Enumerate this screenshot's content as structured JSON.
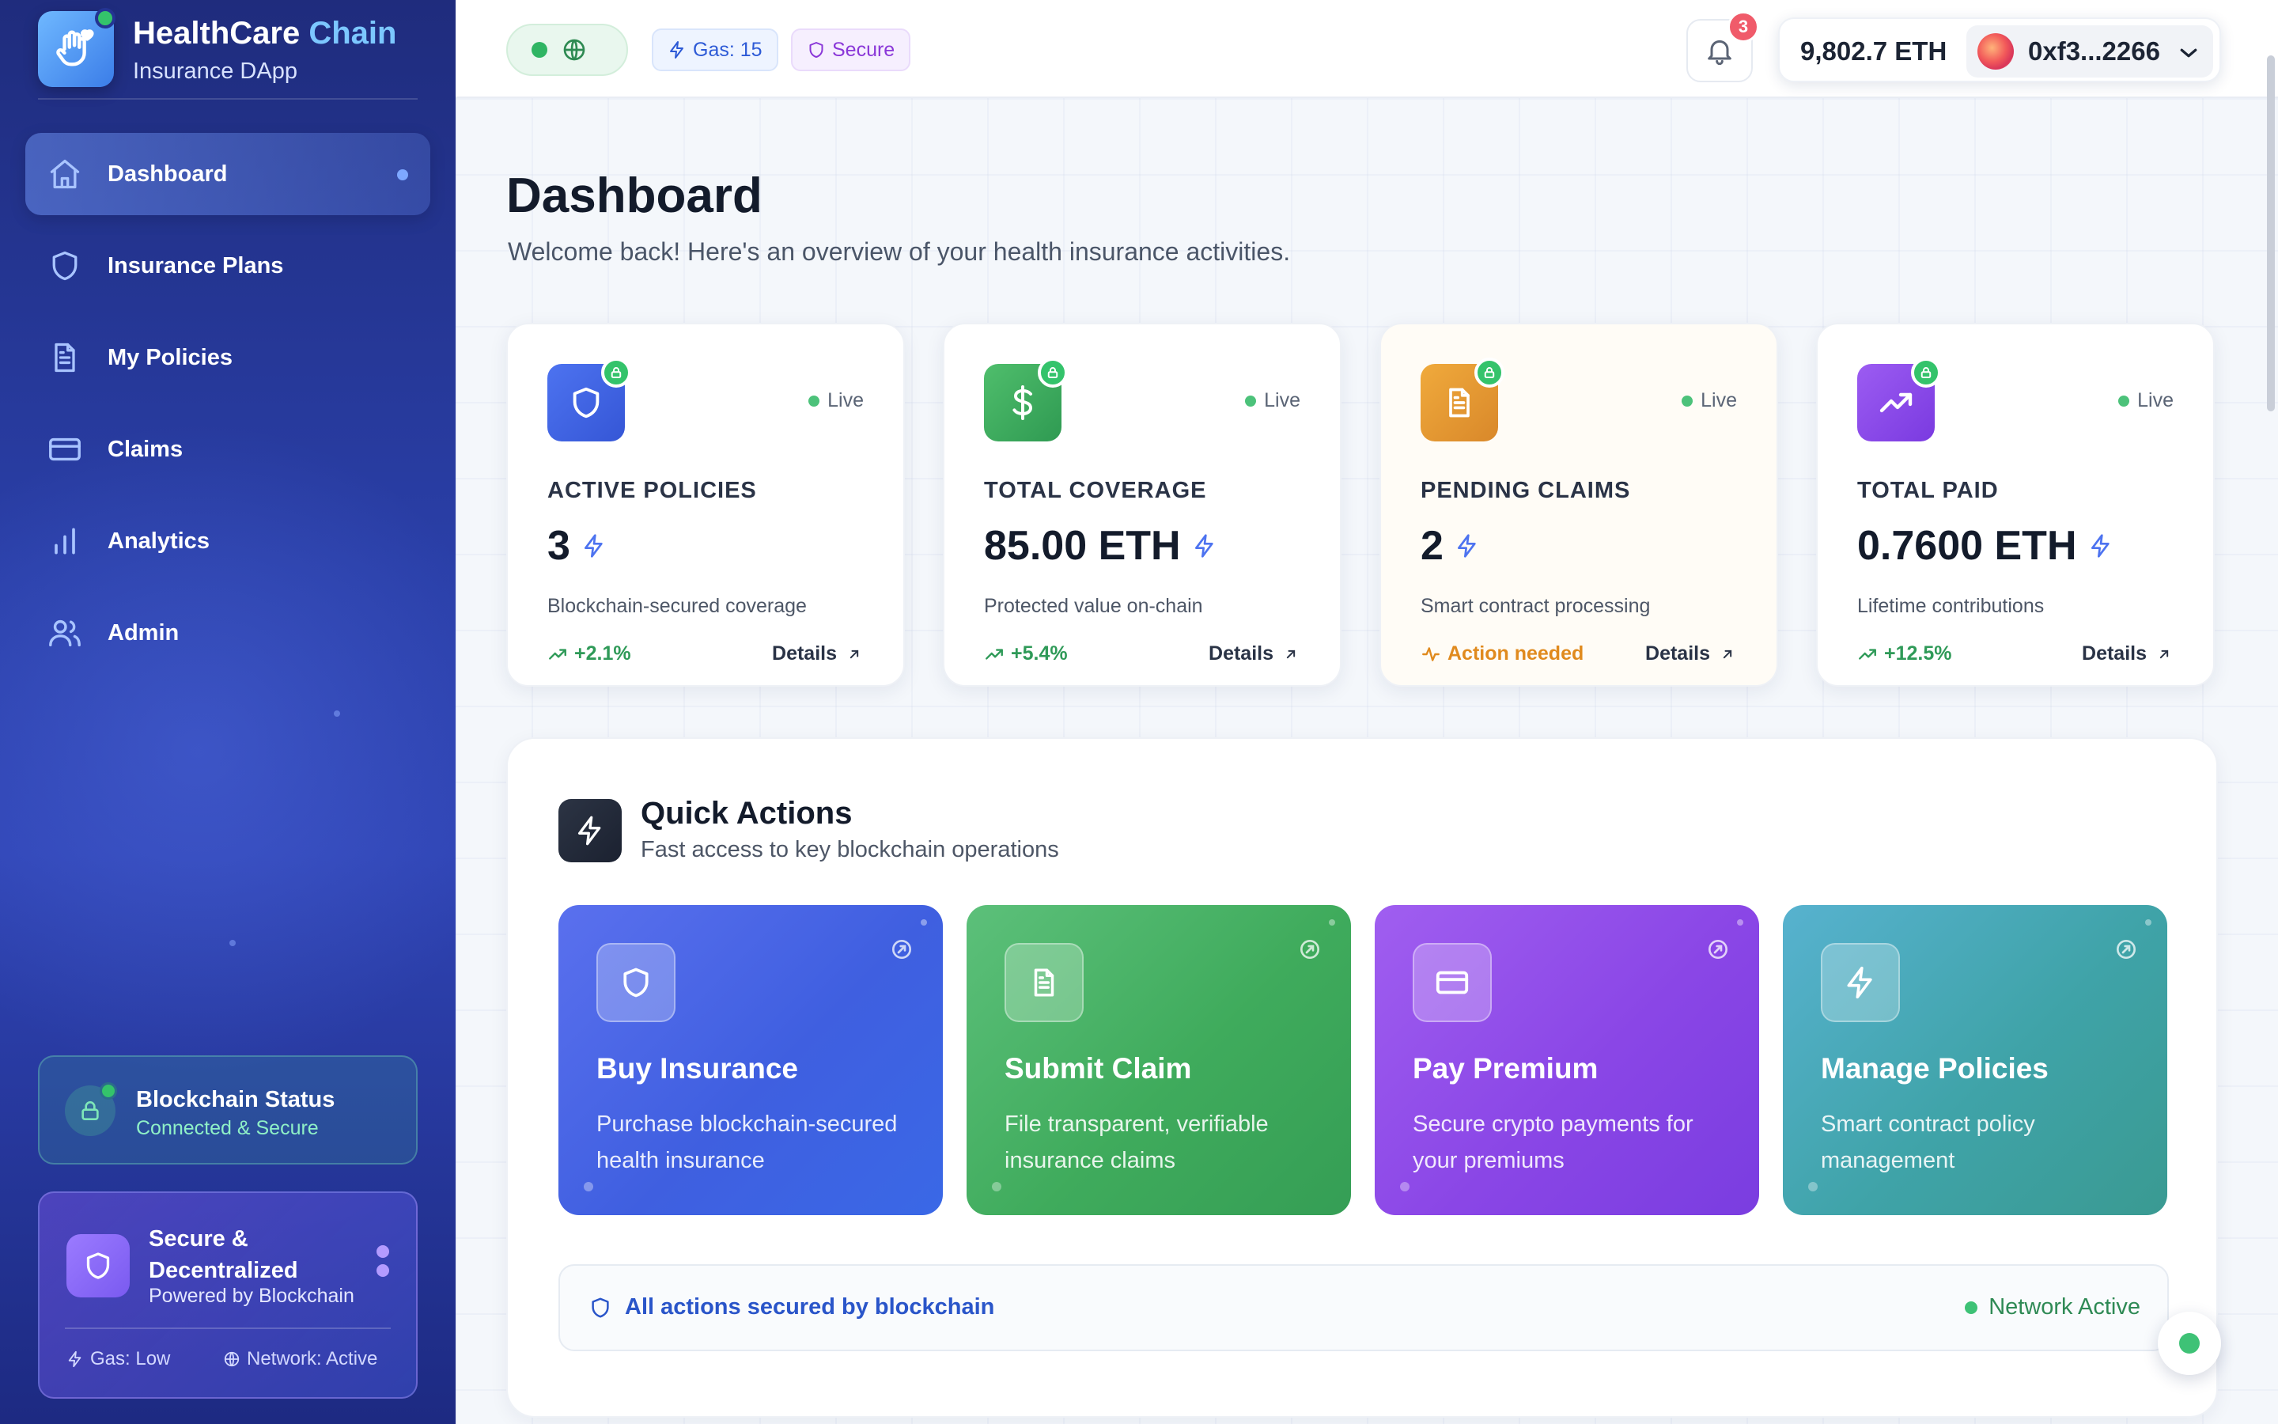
{
  "brand": {
    "title_main": "HealthCare",
    "title_accent": "Chain",
    "subtitle": "Insurance DApp"
  },
  "sidebar": {
    "items": [
      {
        "label": "Dashboard",
        "icon": "home-icon",
        "active": true
      },
      {
        "label": "Insurance Plans",
        "icon": "shield-icon"
      },
      {
        "label": "My Policies",
        "icon": "document-icon"
      },
      {
        "label": "Claims",
        "icon": "credit-card-icon"
      },
      {
        "label": "Analytics",
        "icon": "bar-chart-icon"
      },
      {
        "label": "Admin",
        "icon": "users-icon"
      }
    ],
    "chain_status": {
      "title": "Blockchain Status",
      "subtitle": "Connected & Secure"
    },
    "secure_card": {
      "title": "Secure & Decentralized",
      "subtitle": "Powered by Blockchain",
      "gas": "Gas: Low",
      "network": "Network: Active"
    }
  },
  "header": {
    "gas": "Gas: 15",
    "secure": "Secure",
    "notifications": "3",
    "balance": "9,802.7 ETH",
    "address": "0xf3...2266"
  },
  "page": {
    "title": "Dashboard",
    "subtitle": "Welcome back! Here's an overview of your health insurance activities."
  },
  "stats": [
    {
      "live": "Live",
      "label": "ACTIVE POLICIES",
      "value": "3",
      "desc": "Blockchain-secured coverage",
      "trend": "+2.1%",
      "details": "Details",
      "color": "#3d63e0"
    },
    {
      "live": "Live",
      "label": "TOTAL COVERAGE",
      "value": "85.00 ETH",
      "desc": "Protected value on-chain",
      "trend": "+5.4%",
      "details": "Details",
      "color": "#3aa65a"
    },
    {
      "live": "Live",
      "label": "PENDING CLAIMS",
      "value": "2",
      "desc": "Smart contract processing",
      "trend": "Action needed",
      "details": "Details",
      "color": "#e39a2e"
    },
    {
      "live": "Live",
      "label": "TOTAL PAID",
      "value": "0.7600 ETH",
      "desc": "Lifetime contributions",
      "trend": "+12.5%",
      "details": "Details",
      "color": "#8b46e8"
    }
  ],
  "quick_actions": {
    "title": "Quick Actions",
    "subtitle": "Fast access to key blockchain operations",
    "cards": [
      {
        "name": "Buy Insurance",
        "desc": "Purchase blockchain-secured health insurance",
        "icon": "shield-icon"
      },
      {
        "name": "Submit Claim",
        "desc": "File transparent, verifiable insurance claims",
        "icon": "document-icon"
      },
      {
        "name": "Pay Premium",
        "desc": "Secure crypto payments for your premiums",
        "icon": "credit-card-icon"
      },
      {
        "name": "Manage Policies",
        "desc": "Smart contract policy management",
        "icon": "lightning-icon"
      }
    ],
    "footer_left": "All actions secured by blockchain",
    "footer_right": "Network Active"
  }
}
